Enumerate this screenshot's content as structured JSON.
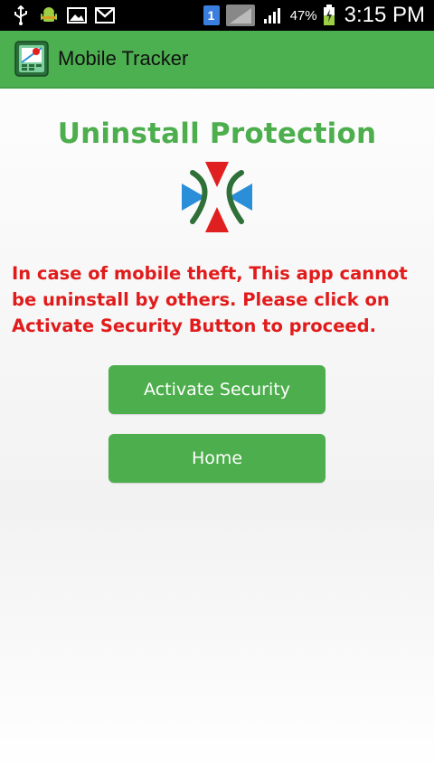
{
  "status_bar": {
    "sim_slot": "1",
    "battery_percent": "47%",
    "time": "3:15 PM",
    "icons": [
      "usb-icon",
      "android-debug-icon",
      "image-icon",
      "gmail-icon",
      "sim-icon",
      "signal-icon",
      "signal-icon",
      "battery-charging-icon"
    ]
  },
  "action_bar": {
    "title": "Mobile Tracker"
  },
  "main": {
    "heading": "Uninstall Protection",
    "message": "In case of mobile theft, This app cannot be uninstall by others. Please click on Activate Security Button to proceed.",
    "activate_button": "Activate Security",
    "home_button": "Home"
  },
  "colors": {
    "accent_green": "#4cae4c",
    "action_bar_green": "#4caf50",
    "warning_red": "#e11b1b",
    "logo_red": "#e02020",
    "logo_blue": "#2a8fd8",
    "logo_dark_green": "#2f6f38"
  }
}
